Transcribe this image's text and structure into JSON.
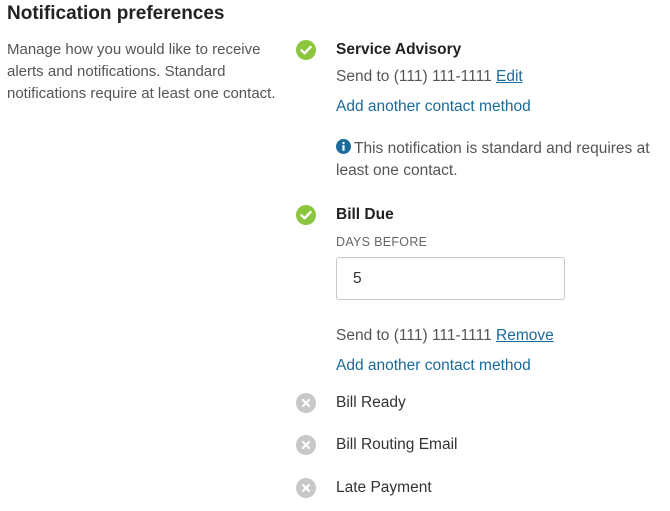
{
  "page": {
    "title": "Notification preferences",
    "description": "Manage how you would like to receive alerts and notifications. Standard notifications require at least one contact."
  },
  "colors": {
    "enabled_icon": "#8cc63f",
    "disabled_icon": "#c8c8c8",
    "link": "#1a6a9a",
    "info_icon": "#1a6a9a"
  },
  "notifications": [
    {
      "name": "Service Advisory",
      "enabled": true,
      "status_icon": "check-circle-icon",
      "send_to_prefix": "Send to",
      "phone": "(111) 111-1111",
      "action_link": "Edit",
      "add_contact_label": "Add another contact method",
      "note_icon": "info-circle-icon",
      "note": "This notification is standard and requires at least one contact."
    },
    {
      "name": "Bill Due",
      "enabled": true,
      "status_icon": "check-circle-icon",
      "days_before_label": "DAYS BEFORE",
      "days_before_value": "5",
      "send_to_prefix": "Send to",
      "phone": "(111) 111-1111",
      "action_link": "Remove",
      "add_contact_label": "Add another contact method"
    },
    {
      "name": "Bill Ready",
      "enabled": false,
      "status_icon": "x-circle-icon"
    },
    {
      "name": "Bill Routing Email",
      "enabled": false,
      "status_icon": "x-circle-icon"
    },
    {
      "name": "Late Payment",
      "enabled": false,
      "status_icon": "x-circle-icon"
    }
  ]
}
